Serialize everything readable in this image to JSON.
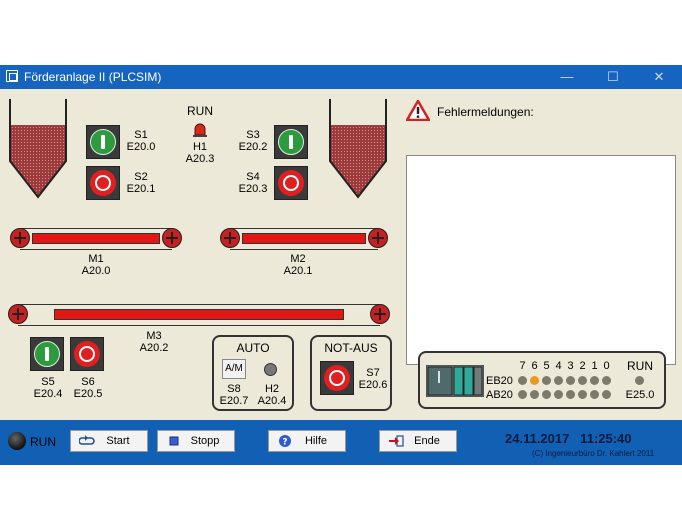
{
  "window": {
    "title": "Förderanlage II (PLCSIM)",
    "controls": {
      "minimize": "—",
      "maximize": "☐",
      "close": "✕"
    }
  },
  "run_top": "RUN",
  "lamp_h1": {
    "name": "H1",
    "addr": "A20.3"
  },
  "s1": {
    "name": "S1",
    "addr": "E20.0"
  },
  "s2": {
    "name": "S2",
    "addr": "E20.1"
  },
  "s3": {
    "name": "S3",
    "addr": "E20.2"
  },
  "s4": {
    "name": "S4",
    "addr": "E20.3"
  },
  "m1": {
    "name": "M1",
    "addr": "A20.0"
  },
  "m2": {
    "name": "M2",
    "addr": "A20.1"
  },
  "m3": {
    "name": "M3",
    "addr": "A20.2"
  },
  "s5": {
    "name": "S5",
    "addr": "E20.4"
  },
  "s6": {
    "name": "S6",
    "addr": "E20.5"
  },
  "auto_panel": {
    "title": "AUTO",
    "am_label": "A/M",
    "s8": "S8",
    "s8_addr": "E20.7",
    "h2": "H2",
    "h2_addr": "A20.4"
  },
  "notaus_panel": {
    "title": "NOT-AUS",
    "s7": "S7",
    "s7_addr": "E20.6"
  },
  "errors": {
    "title": "Fehlermeldungen:",
    "messages": []
  },
  "plc": {
    "bit_header": [
      "7",
      "6",
      "5",
      "4",
      "3",
      "2",
      "1",
      "0"
    ],
    "eb_label": "EB20",
    "ab_label": "AB20",
    "eb_bits": [
      0,
      1,
      0,
      0,
      0,
      0,
      0,
      0
    ],
    "ab_bits": [
      0,
      0,
      0,
      0,
      0,
      0,
      0,
      0
    ],
    "run_label": "RUN",
    "run_addr": "E25.0"
  },
  "statusbar": {
    "run_label": "RUN",
    "buttons": {
      "start": "Start",
      "stop": "Stopp",
      "help": "Hilfe",
      "end": "Ende"
    },
    "datetime": "24.11.2017   11:25:40",
    "copyright": "(C) Ingenieurbüro Dr. Kahlert 2011"
  },
  "colors": {
    "titlebar": "#1565c0",
    "statusbar": "#1160b4",
    "panel_bg": "#ece9d8",
    "belt_bar": "#e31616",
    "led_on": "#e89a20",
    "led_off": "#7d7a6c"
  }
}
